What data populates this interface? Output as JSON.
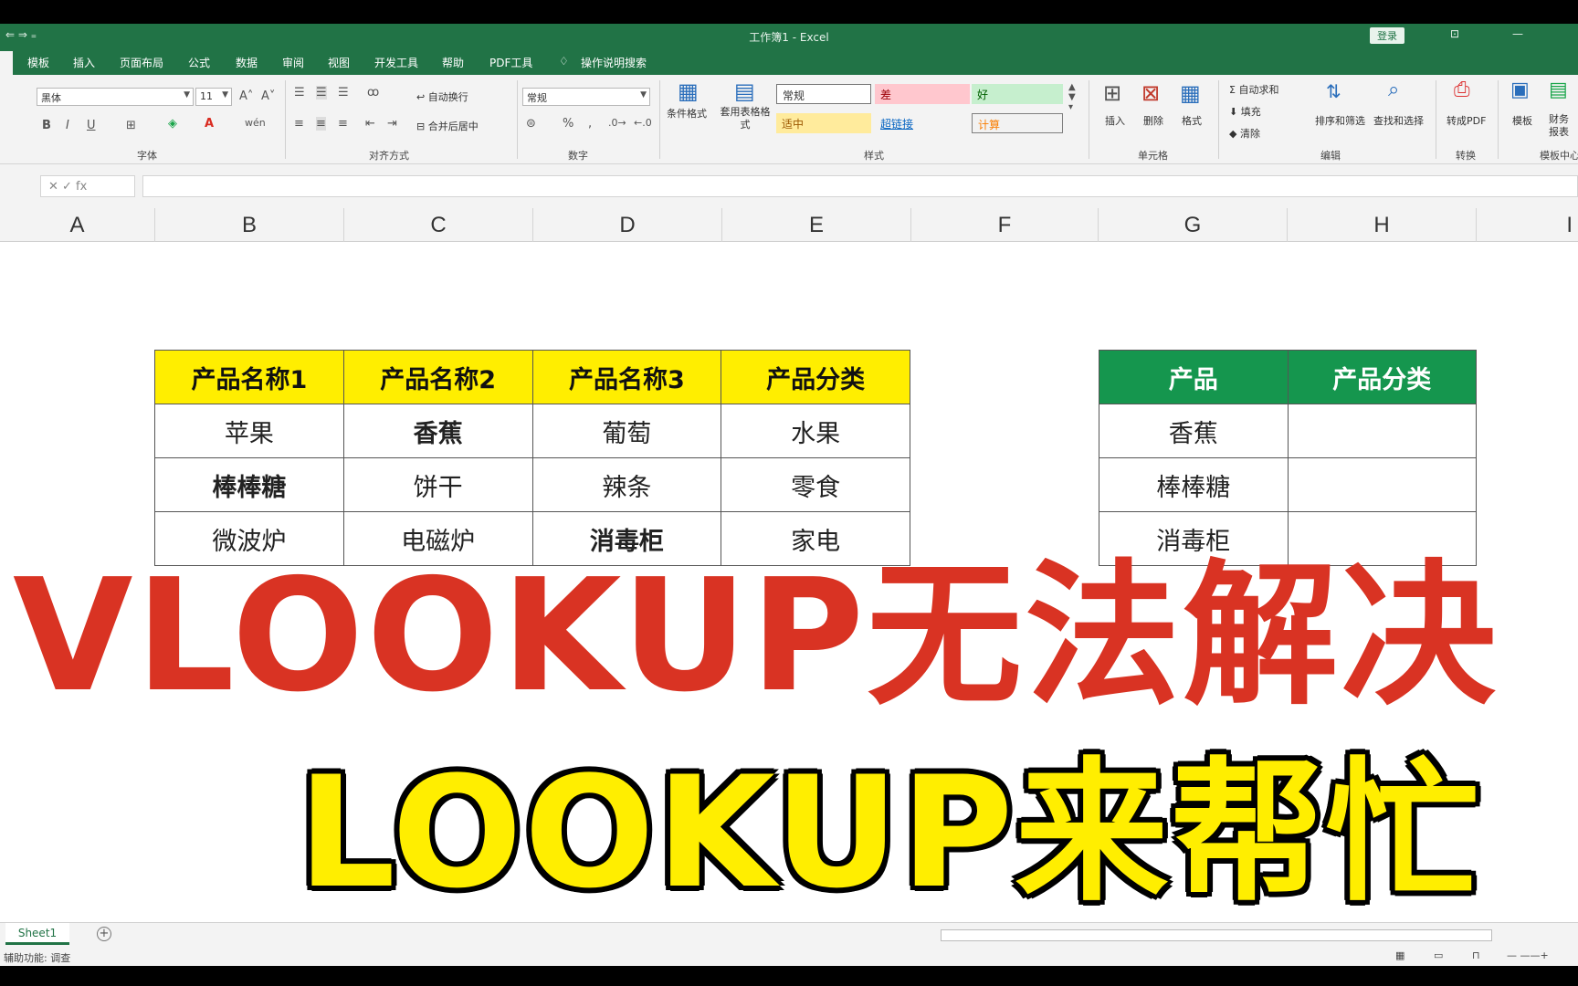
{
  "window": {
    "title": "工作簿1 - Excel",
    "login_label": "登录",
    "qa_label": "⇐ ⇒  ₌"
  },
  "tabs": [
    "模板",
    "插入",
    "页面布局",
    "公式",
    "数据",
    "审阅",
    "视图",
    "开发工具",
    "帮助",
    "PDF工具",
    "操作说明搜索"
  ],
  "ribbon": {
    "font": {
      "name": "黑体",
      "size": "11",
      "label": "字体"
    },
    "align": {
      "wrap": "自动换行",
      "merge": "合并后居中",
      "label": "对齐方式"
    },
    "number": {
      "format": "常规",
      "label": "数字"
    },
    "styles": {
      "cond_format": "条件格式",
      "table_format": "套用表格格式",
      "normal": "常规",
      "bad": "差",
      "good": "好",
      "neutral": "适中",
      "hyperlink": "超链接",
      "calc": "计算",
      "label": "样式"
    },
    "cells": {
      "insert": "插入",
      "delete": "删除",
      "format": "格式",
      "label": "单元格"
    },
    "editing": {
      "autosum": "自动求和",
      "fill": "填充",
      "clear": "清除",
      "sort": "排序和筛选",
      "find": "查找和选择",
      "label": "编辑"
    },
    "convert": {
      "pdf": "转成PDF",
      "label": "转换"
    },
    "templates": {
      "tpl": "模板",
      "finance": "财务报表",
      "label": "模板中心"
    }
  },
  "formula_bar": {
    "fx": "✕  ✓  fx"
  },
  "columns": [
    "A",
    "B",
    "C",
    "D",
    "E",
    "F",
    "G",
    "H",
    "I"
  ],
  "table1": {
    "headers": [
      "产品名称1",
      "产品名称2",
      "产品名称3",
      "产品分类"
    ],
    "rows": [
      [
        "苹果",
        "香蕉",
        "葡萄",
        "水果"
      ],
      [
        "棒棒糖",
        "饼干",
        "辣条",
        "零食"
      ],
      [
        "微波炉",
        "电磁炉",
        "消毒柜",
        "家电"
      ]
    ]
  },
  "table2": {
    "headers": [
      "产品",
      "产品分类"
    ],
    "rows": [
      [
        "香蕉",
        ""
      ],
      [
        "棒棒糖",
        ""
      ],
      [
        "消毒柜",
        ""
      ]
    ]
  },
  "banner": {
    "line1": "VLOOKUP无法解决",
    "line2": "LOOKUP来帮忙"
  },
  "sheets": [
    "Sheet1"
  ],
  "status": {
    "text": "辅助功能: 调查"
  },
  "colors": {
    "excel_green": "#217346",
    "highlight_red": "#e02c20",
    "header_yellow": "#ffee00",
    "header_green": "#15964e"
  }
}
